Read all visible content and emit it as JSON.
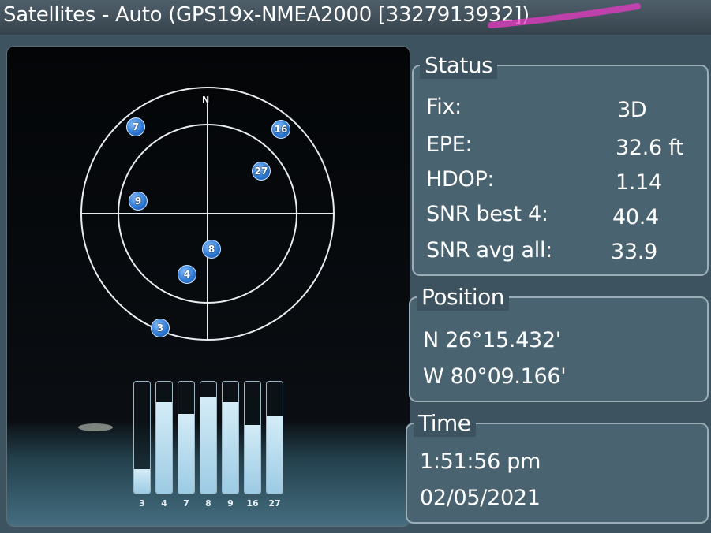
{
  "window": {
    "title": "Satellites - Auto (GPS19x-NMEA2000 [3327913932])"
  },
  "skyplot": {
    "north_label": "N",
    "satellites": [
      "7",
      "16",
      "27",
      "9",
      "8",
      "4",
      "3"
    ]
  },
  "signal_bars": [
    {
      "id": "3",
      "level": 0.22
    },
    {
      "id": "4",
      "level": 0.82
    },
    {
      "id": "7",
      "level": 0.71
    },
    {
      "id": "8",
      "level": 0.86
    },
    {
      "id": "9",
      "level": 0.82
    },
    {
      "id": "16",
      "level": 0.61
    },
    {
      "id": "27",
      "level": 0.69
    }
  ],
  "status": {
    "heading": "Status",
    "fix_label": "Fix:",
    "fix_value": "3D",
    "epe_label": "EPE:",
    "epe_value": "32.6 ft",
    "hdop_label": "HDOP:",
    "hdop_value": "1.14",
    "snr_best_label": "SNR best 4:",
    "snr_best_value": "40.4",
    "snr_avg_label": "SNR avg all:",
    "snr_avg_value": "33.9"
  },
  "position": {
    "heading": "Position",
    "lat": "N  26°15.432'",
    "lon": "W  80°09.166'"
  },
  "time": {
    "heading": "Time",
    "clock": "1:51:56 pm",
    "date": "02/05/2021"
  },
  "colors": {
    "satellite": "#2d7ad6",
    "signal_bar": "#b8dcef",
    "background": "#3d5360"
  }
}
